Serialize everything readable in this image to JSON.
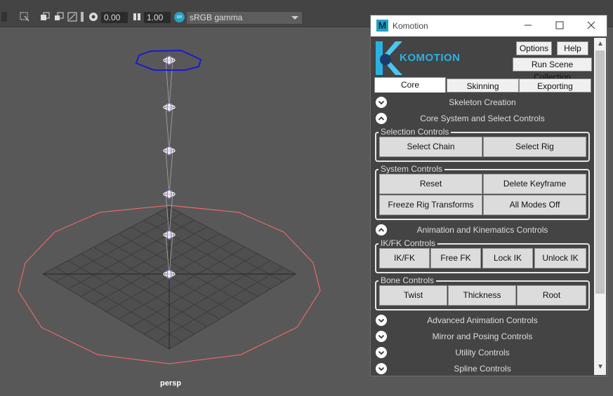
{
  "toolbar": {
    "field1_value": "0.00",
    "field2_value": "1.00",
    "colorspace_value": "sRGB gamma",
    "colorspace_badge": "on"
  },
  "viewport": {
    "camera_label": "persp"
  },
  "komotion_window": {
    "title": "Komotion",
    "app_icon_letter": "M",
    "brand_name": "KOMOTION",
    "buttons": {
      "options": "Options",
      "help": "Help",
      "run_scene_collection": "Run Scene Collection"
    },
    "tabs": [
      {
        "label": "Core",
        "active": true
      },
      {
        "label": "Skinning",
        "active": false
      },
      {
        "label": "Exporting",
        "active": false
      }
    ],
    "sections": {
      "skeleton_creation": {
        "label": "Skeleton Creation",
        "expanded": false
      },
      "core_system": {
        "label": "Core System and Select Controls",
        "expanded": true
      },
      "animation": {
        "label": "Animation and Kinematics Controls",
        "expanded": true
      },
      "advanced": {
        "label": "Advanced Animation Controls",
        "expanded": false
      },
      "mirror": {
        "label": "Mirror and Posing Controls",
        "expanded": false
      },
      "utility": {
        "label": "Utility Controls",
        "expanded": false
      },
      "spline": {
        "label": "Spline Controls",
        "expanded": false
      }
    },
    "groups": {
      "selection": {
        "title": "Selection Controls",
        "buttons": [
          "Select Chain",
          "Select Rig"
        ]
      },
      "system": {
        "title": "System Controls",
        "buttons": [
          "Reset",
          "Delete Keyframe",
          "Freeze Rig Transforms",
          "All Modes Off"
        ]
      },
      "ikfk": {
        "title": "IK/FK Controls",
        "buttons": [
          "IK/FK",
          "Free FK",
          "Lock IK",
          "Unlock IK"
        ]
      },
      "bone": {
        "title": "Bone Controls",
        "buttons": [
          "Twist",
          "Thickness",
          "Root"
        ]
      }
    }
  },
  "colors": {
    "viewport_bg": "#585858",
    "grid_line": "#3c3c3c",
    "circle_outline": "#ff6b6b",
    "selected_octagon": "#1a1ad4",
    "brand_accent": "#2ab1e2"
  }
}
